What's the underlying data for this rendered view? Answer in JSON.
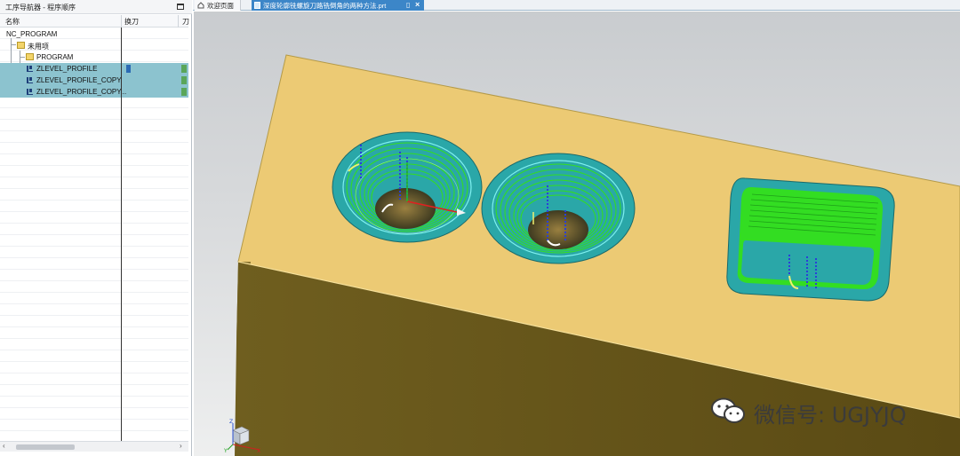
{
  "navigator": {
    "title": "工序导航器 - 程序顺序",
    "columns": [
      "名称",
      "换刀",
      "刀"
    ],
    "tree": [
      {
        "label": "NC_PROGRAM",
        "level": 0,
        "kind": "root",
        "selected": false
      },
      {
        "label": "未用项",
        "level": 1,
        "kind": "folder",
        "selected": false
      },
      {
        "label": "PROGRAM",
        "level": 2,
        "kind": "folder",
        "selected": false
      },
      {
        "label": "ZLEVEL_PROFILE",
        "level": 2,
        "kind": "operation",
        "selected": true
      },
      {
        "label": "ZLEVEL_PROFILE_COPY",
        "level": 2,
        "kind": "operation",
        "selected": true
      },
      {
        "label": "ZLEVEL_PROFILE_COPY...",
        "level": 2,
        "kind": "operation",
        "selected": true
      }
    ]
  },
  "tabs": [
    {
      "label": "欢迎页面",
      "icon": "home-icon",
      "active": false
    },
    {
      "label": "深度轮廓铣螺旋刀路铣倒角的两种方法.prt",
      "icon": "part-icon",
      "active": true
    }
  ],
  "viewport": {
    "watermark": "微信号: UGJYJQ",
    "triad_labels": [
      "Z",
      "Y",
      "X"
    ]
  },
  "colors": {
    "selection": "#8cc3cf",
    "active_tab": "#3c86c8",
    "part_top": "#ecca74",
    "part_side": "#6a5a1e",
    "toolpath": "#33dd22",
    "chamfer": "#2aa7a8"
  }
}
